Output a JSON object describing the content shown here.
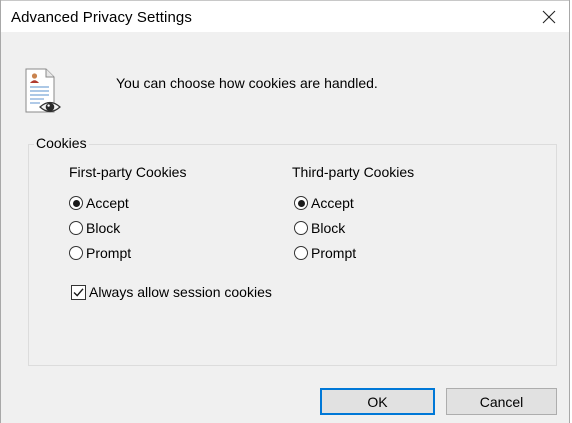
{
  "window": {
    "title": "Advanced Privacy Settings",
    "close_glyph": "✕"
  },
  "header": {
    "icon": "privacy-document-eye-icon",
    "text": "You can choose how cookies are handled."
  },
  "cookies": {
    "group_label": "Cookies",
    "first_party": {
      "heading": "First-party Cookies",
      "options": [
        "Accept",
        "Block",
        "Prompt"
      ],
      "selected": "Accept"
    },
    "third_party": {
      "heading": "Third-party Cookies",
      "options": [
        "Accept",
        "Block",
        "Prompt"
      ],
      "selected": "Accept"
    },
    "session": {
      "label": "Always allow session cookies",
      "checked": true
    }
  },
  "buttons": {
    "ok": "OK",
    "cancel": "Cancel"
  },
  "colors": {
    "dialog_bg": "#f0f0f0",
    "default_button_border": "#0078d7"
  }
}
